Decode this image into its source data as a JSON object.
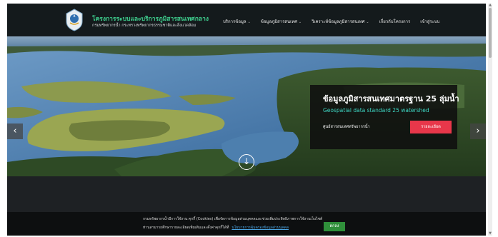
{
  "header": {
    "title": "โครงการระบบและบริการภูมิสารสนเทศกลาง",
    "subtitle": "กรมทรัพยากรน้ำ กระทรวงทรัพยากรธรรมชาติและสิ่งแวดล้อม",
    "logo_icon": "agency-seal-icon"
  },
  "nav": {
    "items": [
      {
        "label": "บริการข้อมูล",
        "caret": "⌄"
      },
      {
        "label": "ข้อมูลภูมิสารสนเทศ",
        "caret": "⌄"
      },
      {
        "label": "วิเคราะห์ข้อมูลภูมิสารสนเทศ",
        "caret": "⌄"
      },
      {
        "label": "เกี่ยวกับโครงการ",
        "caret": ""
      },
      {
        "label": "เข้าสู่ระบบ",
        "caret": ""
      }
    ]
  },
  "hero": {
    "title": "ข้อมูลภูมิสารสนเทศมาตรฐาน 25 ลุ่มน้ำ",
    "subtitle": "Geospatial data standard 25 watershed",
    "organization": "ศูนย์สารสนเทศทรัพยากรน้ำ",
    "button_label": "รายละเอียด",
    "prev_glyph": "‹",
    "next_glyph": "›",
    "scroll_glyph": "↓",
    "accent_color": "#3ed6c2",
    "button_color": "#e8374a"
  },
  "cookie": {
    "line1": "กรมทรัพยากรน้ำมีการใช้งาน คุกกี้ (Cookies) เพื่อจัดการข้อมูลส่วนบุคคลและช่วยเพิ่มประสิทธิภาพการใช้งานเว็บไซต์",
    "line2": "ท่านสามารถศึกษารายละเอียดเพิ่มเติมและตั้งค่าคุกกี้ได้ที่",
    "link": "นโยบายการคุ้มครองข้อมูลส่วนบุคคล",
    "accept_label": "ตกลง"
  }
}
